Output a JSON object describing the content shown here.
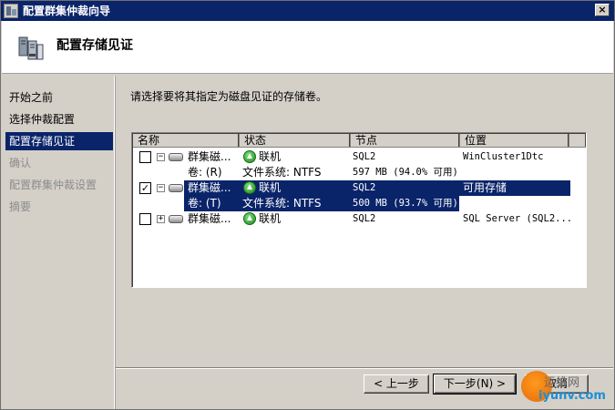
{
  "window": {
    "title": "配置群集仲裁向导",
    "close_glyph": "×"
  },
  "header": {
    "title": "配置存储见证"
  },
  "nav": {
    "items": [
      {
        "label": "开始之前",
        "state": "normal"
      },
      {
        "label": "选择仲裁配置",
        "state": "normal"
      },
      {
        "label": "配置存储见证",
        "state": "active"
      },
      {
        "label": "确认",
        "state": "disabled"
      },
      {
        "label": "配置群集仲裁设置",
        "state": "disabled"
      },
      {
        "label": "摘要",
        "state": "disabled"
      }
    ]
  },
  "main": {
    "instruction": "请选择要将其指定为磁盘见证的存储卷。"
  },
  "list": {
    "columns": [
      "名称",
      "状态",
      "节点",
      "位置"
    ],
    "rows": [
      {
        "checked": false,
        "expander": "−",
        "name": "群集磁...",
        "status": "联机",
        "node": "SQL2",
        "location": "WinCluster1Dtc",
        "volume": "卷: (R)",
        "fs": "文件系统: NTFS",
        "size": "597 MB (94.0% 可用)",
        "selected": false
      },
      {
        "checked": true,
        "expander": "−",
        "name": "群集磁...",
        "status": "联机",
        "node": "SQL2",
        "location": "可用存储",
        "volume": "卷: (T)",
        "fs": "文件系统: NTFS",
        "size": "500 MB (93.7% 可用)",
        "selected": true
      },
      {
        "checked": false,
        "expander": "+",
        "name": "群集磁...",
        "status": "联机",
        "node": "SQL2",
        "location": "SQL Server (SQL2...",
        "selected": false
      }
    ]
  },
  "buttons": {
    "prev": "< 上一步",
    "next": "下一步(N) >",
    "cancel": "取消"
  },
  "watermark": {
    "top": "运维网",
    "bottom": "iyunv.com"
  },
  "colors": {
    "selection": "#0a246a",
    "status_ok": "#1d8a1d",
    "watermark_orange": "#e3690a",
    "watermark_blue": "#1e8fd6"
  },
  "icons": {
    "title": "cluster-wizard-icon",
    "header": "server-cluster-icon",
    "disk": "disk-icon",
    "status": "online-arrow-icon"
  }
}
